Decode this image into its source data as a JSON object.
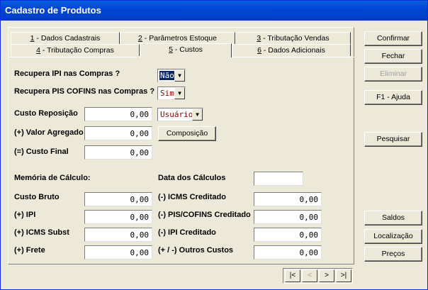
{
  "window": {
    "title": "Cadastro de Produtos"
  },
  "tabs_row1": [
    {
      "key": "1",
      "label": " - Dados Cadastrais"
    },
    {
      "key": "2",
      "label": " - Parâmetros Estoque"
    },
    {
      "key": "3",
      "label": " - Tributação Vendas"
    }
  ],
  "tabs_row2": [
    {
      "key": "4",
      "label": " - Tributação Compras"
    },
    {
      "key": "5",
      "label": " - Custos"
    },
    {
      "key": "6",
      "label": " - Dados Adicionais"
    }
  ],
  "form": {
    "recupera_ipi_label": "Recupera IPI nas Compras ?",
    "recupera_ipi_value": "Não",
    "recupera_pis_label": "Recupera PIS COFINS nas Compras ?",
    "recupera_pis_value": "Sim",
    "custo_reposicao_label": "Custo Reposição",
    "custo_reposicao_value": "0,00",
    "usuario_value": "Usuário",
    "valor_agregado_label": "(+) Valor Agregado",
    "valor_agregado_value": "0,00",
    "composicao_label": "Composição",
    "custo_final_label": "(=) Custo Final",
    "custo_final_value": "0,00",
    "memoria_label": "Memória de Cálculo:",
    "data_calculos_label": "Data dos Cálculos",
    "data_calculos_value": "",
    "custo_bruto_label": "Custo Bruto",
    "custo_bruto_value": "0,00",
    "ipi_label": "(+) IPI",
    "ipi_value": "0,00",
    "icms_subst_label": "(+) ICMS Subst",
    "icms_subst_value": "0,00",
    "frete_label": "(+) Frete",
    "frete_value": "0,00",
    "icms_cred_label": "(-) ICMS Creditado",
    "icms_cred_value": "0,00",
    "pis_cred_label": "(-) PIS/COFINS Creditado",
    "pis_cred_value": "0,00",
    "ipi_cred_label": "(-) IPI Creditado",
    "ipi_cred_value": "0,00",
    "outros_label": "(+ / -) Outros Custos",
    "outros_value": "0,00"
  },
  "side_buttons": {
    "confirmar": "Confirmar",
    "fechar": "Fechar",
    "eliminar": "Eliminar",
    "ajuda": "F1 - Ajuda",
    "pesquisar": "Pesquisar",
    "saldos": "Saldos",
    "localizacao": "Localização",
    "precos": "Preços"
  },
  "nav": {
    "first": "|<",
    "prev": "<",
    "next": ">",
    "last": ">|"
  }
}
